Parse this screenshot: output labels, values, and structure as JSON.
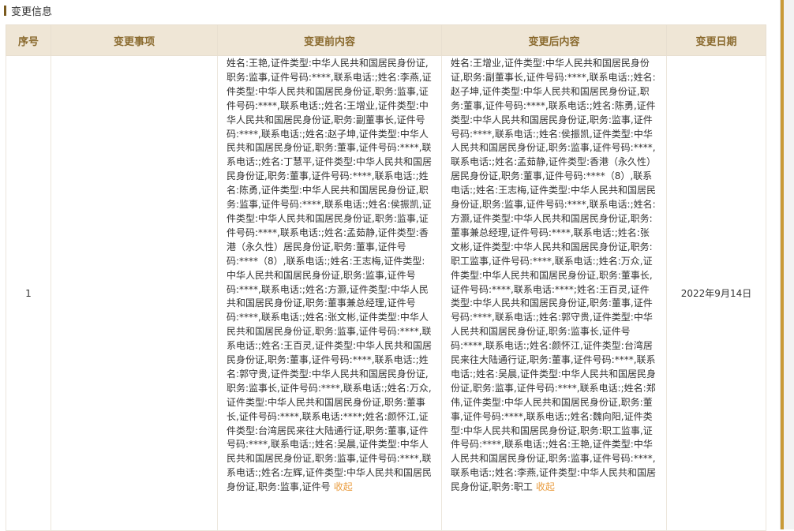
{
  "section": {
    "title": "变更信息"
  },
  "table": {
    "headers": [
      "序号",
      "变更事项",
      "变更前内容",
      "变更后内容",
      "变更日期"
    ],
    "rows": [
      {
        "index": "1",
        "item": "",
        "before": "姓名:王艳,证件类型:中华人民共和国居民身份证,职务:监事,证件号码:****,联系电话:;姓名:李燕,证件类型:中华人民共和国居民身份证,职务:监事,证件号码:****,联系电话:;姓名:王增业,证件类型:中华人民共和国居民身份证,职务:副董事长,证件号码:****,联系电话:;姓名:赵子坤,证件类型:中华人民共和国居民身份证,职务:董事,证件号码:****,联系电话:;姓名:丁慧平,证件类型:中华人民共和国居民身份证,职务:董事,证件号码:****,联系电话:;姓名:陈勇,证件类型:中华人民共和国居民身份证,职务:监事,证件号码:****,联系电话:;姓名:侯振凯,证件类型:中华人民共和国居民身份证,职务:监事,证件号码:****,联系电话:;姓名:孟茹静,证件类型:香港（永久性）居民身份证,职务:董事,证件号码:****（8）,联系电话:;姓名:王志梅,证件类型:中华人民共和国居民身份证,职务:监事,证件号码:****,联系电话:;姓名:方灏,证件类型:中华人民共和国居民身份证,职务:董事兼总经理,证件号码:****,联系电话:;姓名:张文彬,证件类型:中华人民共和国居民身份证,职务:监事,证件号码:****,联系电话:;姓名:王百灵,证件类型:中华人民共和国居民身份证,职务:董事,证件号码:****,联系电话:;姓名:郭守贵,证件类型:中华人民共和国居民身份证,职务:监事长,证件号码:****,联系电话:;姓名:万众,证件类型:中华人民共和国居民身份证,职务:董事长,证件号码:****,联系电话:****;姓名:颜怀江,证件类型:台湾居民来往大陆通行证,职务:董事,证件号码:****,联系电话:;姓名:吴晨,证件类型:中华人民共和国居民身份证,职务:监事,证件号码:****,联系电话:;姓名:左辉,证件类型:中华人民共和国居民身份证,职务:监事,证件号",
        "after": "姓名:王增业,证件类型:中华人民共和国居民身份证,职务:副董事长,证件号码:****,联系电话:;姓名:赵子坤,证件类型:中华人民共和国居民身份证,职务:董事,证件号码:****,联系电话:;姓名:陈勇,证件类型:中华人民共和国居民身份证,职务:监事,证件号码:****,联系电话:;姓名:侯振凯,证件类型:中华人民共和国居民身份证,职务:监事,证件号码:****,联系电话:;姓名:孟茹静,证件类型:香港（永久性）居民身份证,职务:董事,证件号码:****（8）,联系电话:;姓名:王志梅,证件类型:中华人民共和国居民身份证,职务:监事,证件号码:****,联系电话:;姓名:方灏,证件类型:中华人民共和国居民身份证,职务:董事兼总经理,证件号码:****,联系电话:;姓名:张文彬,证件类型:中华人民共和国居民身份证,职务:职工监事,证件号码:****,联系电话:;姓名:万众,证件类型:中华人民共和国居民身份证,职务:董事长,证件号码:****,联系电话:****;姓名:王百灵,证件类型:中华人民共和国居民身份证,职务:董事,证件号码:****,联系电话:;姓名:郭守贵,证件类型:中华人民共和国居民身份证,职务:监事长,证件号码:****,联系电话:;姓名:颜怀江,证件类型:台湾居民来往大陆通行证,职务:董事,证件号码:****,联系电话:;姓名:吴晨,证件类型:中华人民共和国居民身份证,职务:监事,证件号码:****,联系电话:;姓名:郑伟,证件类型:中华人民共和国居民身份证,职务:董事,证件号码:****,联系电话:;姓名:魏向阳,证件类型:中华人民共和国居民身份证,职务:职工监事,证件号码:****,联系电话:;姓名:王艳,证件类型:中华人民共和国居民身份证,职务:监事,证件号码:****,联系电话:;姓名:李燕,证件类型:中华人民共和国居民身份证,职务:职工",
        "date": "2022年9月14日",
        "collapse_label": "收起"
      }
    ]
  },
  "colors": {
    "header_bg": "#efe6d6",
    "header_text": "#8a6a2e",
    "collapse_link": "#e99b3d",
    "accent_bar": "#c99a37"
  }
}
